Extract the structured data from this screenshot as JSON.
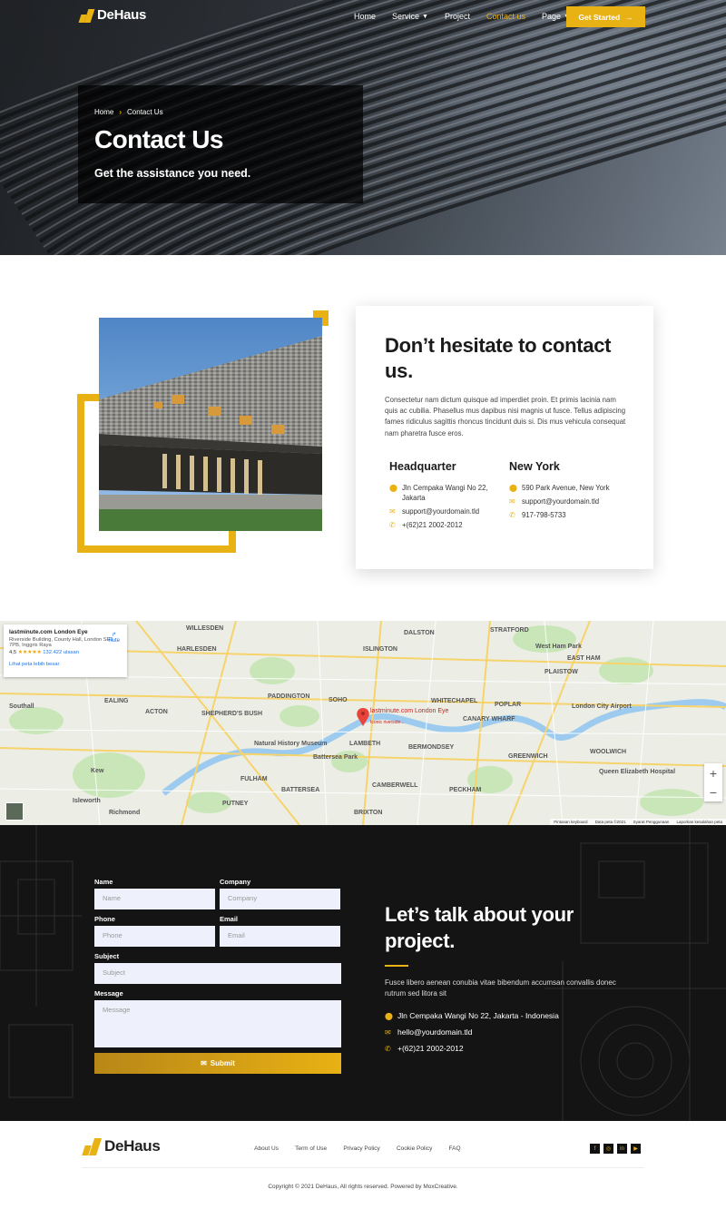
{
  "brand": {
    "name": "DeHaus",
    "accent": "#e8b114",
    "dark": "#141414"
  },
  "nav": {
    "items": [
      {
        "label": "Home",
        "active": false,
        "dropdown": false
      },
      {
        "label": "Service",
        "active": false,
        "dropdown": true
      },
      {
        "label": "Project",
        "active": false,
        "dropdown": false
      },
      {
        "label": "Contact us",
        "active": true,
        "dropdown": false
      },
      {
        "label": "Page",
        "active": false,
        "dropdown": true
      }
    ],
    "cta_label": "Get Started"
  },
  "hero": {
    "breadcrumb": [
      "Home",
      "Contact Us"
    ],
    "title": "Contact Us",
    "subtitle": "Get the assistance you need."
  },
  "contact": {
    "heading": "Don’t hesitate to contact us.",
    "description": "Consectetur nam dictum quisque ad imperdiet proin. Et primis lacinia nam quis ac cubilia. Phasellus mus dapibus nisi magnis ut fusce. Tellus adipiscing fames ridiculus sagittis rhoncus tincidunt duis si. Dis mus vehicula consequat nam pharetra fusce eros.",
    "offices": [
      {
        "name": "Headquarter",
        "address": "Jln Cempaka Wangi No 22, Jakarta",
        "email": "support@yourdomain.tld",
        "phone": "+(62)21 2002-2012"
      },
      {
        "name": "New York",
        "address": "590 Park Avenue, New York",
        "email": "support@yourdomain.tld",
        "phone": "917-798-5733"
      }
    ]
  },
  "map": {
    "place_title": "lastminute.com London Eye",
    "place_address": "Riverside Building, County Hall, London SE1 7PB, Inggris Raya",
    "rating": "4,5",
    "stars": "★★★★★",
    "reviews": "132.422 ulasan",
    "route_label": "Rute",
    "bigger_map_link": "Lihat peta lebih besar",
    "pin_label": "lastminute.com London Eye",
    "pin_sublabel": "Iconic riverside...",
    "labels": [
      "WILLESDEN",
      "HARLESDEN",
      "ISLINGTON",
      "DALSTON",
      "STRATFORD",
      "West Ham Park",
      "EAST HAM",
      "PLAISTOW",
      "PADDINGTON",
      "SOHO",
      "WHITECHAPEL",
      "POPLAR",
      "EALING",
      "ACTON",
      "SHEPHERD'S BUSH",
      "LAMBETH",
      "BERMONDSEY",
      "CANARY WHARF",
      "GREENWICH",
      "WOOLWICH",
      "FULHAM",
      "BATTERSEA",
      "CAMBERWELL",
      "PECKHAM",
      "PUTNEY",
      "BRIXTON",
      "London City Airport",
      "Natural History Museum",
      "Battersea Park",
      "Queen Elizabeth Hospital",
      "Kew",
      "Richmond",
      "Isleworth",
      "Southall"
    ],
    "footer": [
      "Pintasan keyboard",
      "Data peta ©2021",
      "Syarat Penggunaan",
      "Laporkan kesalahan peta"
    ],
    "zoom_in": "+",
    "zoom_out": "−"
  },
  "form": {
    "name_label": "Name",
    "name_placeholder": "Name",
    "company_label": "Company",
    "company_placeholder": "Company",
    "phone_label": "Phone",
    "phone_placeholder": "Phone",
    "email_label": "Email",
    "email_placeholder": "Email",
    "subject_label": "Subject",
    "subject_placeholder": "Subject",
    "message_label": "Message",
    "message_placeholder": "Message",
    "submit_label": "Submit"
  },
  "talk": {
    "heading": "Let’s talk about your project.",
    "text": "Fusce libero aenean conubia vitae bibendum accumsan convallis donec rutrum sed litora sit",
    "address": "Jln Cempaka Wangi No 22, Jakarta - Indonesia",
    "email": "hello@yourdomain.tld",
    "phone": "+(62)21 2002-2012"
  },
  "footer": {
    "links": [
      "About Us",
      "Term of Use",
      "Privacy Policy",
      "Cookie Policy",
      "FAQ"
    ],
    "social": [
      "facebook-icon",
      "instagram-icon",
      "linkedin-icon",
      "youtube-icon"
    ],
    "copyright": "Copyright © 2021 DeHaus, All rights reserved. Powered by MoxCreative."
  }
}
